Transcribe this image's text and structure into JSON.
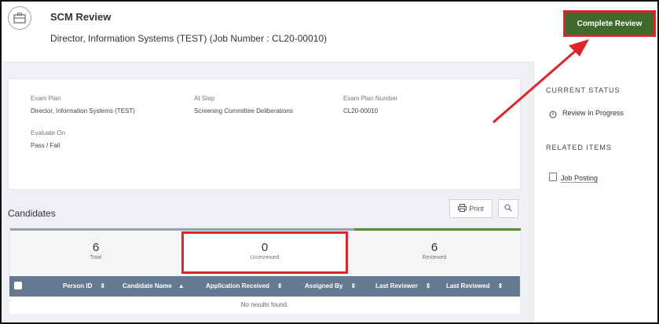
{
  "header": {
    "title": "SCM Review",
    "subtitle": "Director, Information Systems (TEST) (Job Number : CL20-00010)",
    "complete_label": "Complete Review"
  },
  "details": {
    "exam_plan_label": "Exam Plan",
    "exam_plan_value": "Director, Information Systems (TEST)",
    "at_step_label": "At Step",
    "at_step_value": "Screening Committee Deliberations",
    "exam_plan_number_label": "Exam Plan Number",
    "exam_plan_number_value": "CL20-00010",
    "evaluate_on_label": "Evaluate On",
    "evaluate_on_value": "Pass / Fail"
  },
  "candidates": {
    "title": "Candidates",
    "print_label": "Print",
    "tabs": [
      {
        "count": "6",
        "label": "Total"
      },
      {
        "count": "0",
        "label": "Unreviewed"
      },
      {
        "count": "6",
        "label": "Reviewed"
      }
    ],
    "columns": [
      "Person ID",
      "Candidate Name",
      "Application Received",
      "Assigned By",
      "Last Reviewer",
      "Last Reviewed"
    ],
    "empty_text": "No results found."
  },
  "sidebar": {
    "status_heading": "CURRENT STATUS",
    "status_value": "Review In Progress",
    "related_heading": "RELATED ITEMS",
    "related_item": "Job Posting"
  },
  "colors": {
    "complete_button": "#3e6b2b",
    "highlight": "#e0242b",
    "table_header": "#657991"
  },
  "icons": [
    "briefcase-icon",
    "printer-icon",
    "search-icon",
    "clock-icon",
    "checkbox-icon",
    "sort-icon"
  ]
}
